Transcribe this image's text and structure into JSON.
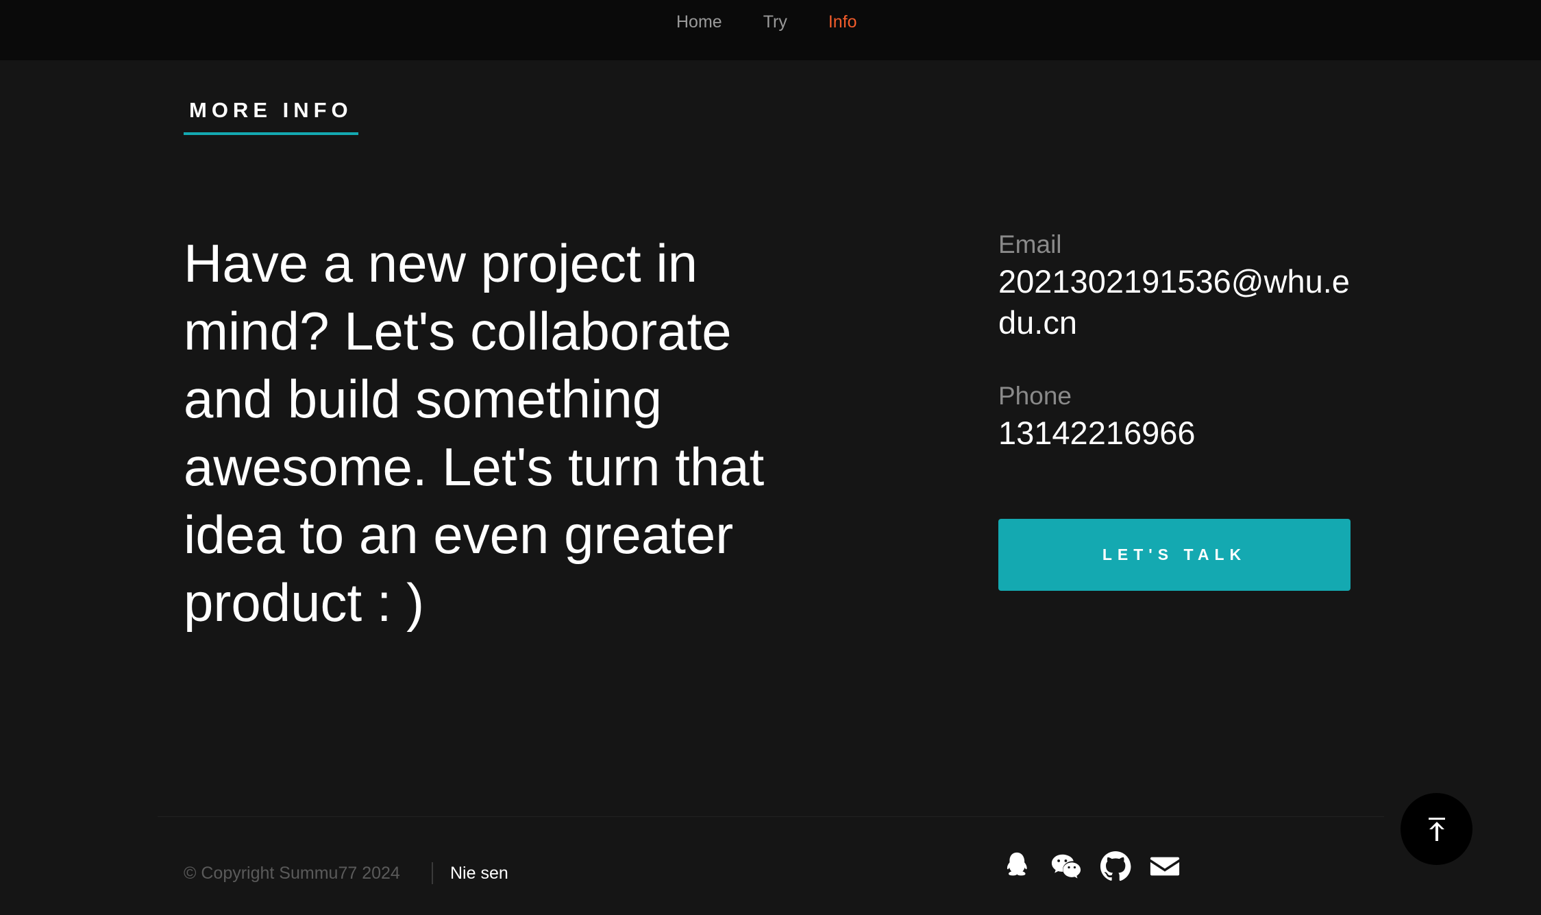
{
  "nav": {
    "items": [
      {
        "label": "Home",
        "active": false
      },
      {
        "label": "Try",
        "active": false
      },
      {
        "label": "Info",
        "active": true
      }
    ],
    "active_color": "#f25c2b"
  },
  "section": {
    "label": "MORE INFO"
  },
  "headline": "Have a new project in mind? Let's collaborate and build something awesome. Let's turn that idea to an even greater product : )",
  "contact": {
    "email_label": "Email",
    "email_value": "2021302191536@whu.edu.cn",
    "phone_label": "Phone",
    "phone_value": "13142216966"
  },
  "cta": {
    "label": "LET'S TALK",
    "color": "#14a9b1"
  },
  "footer": {
    "copyright": "© Copyright Summu77 2024",
    "author": "Nie sen",
    "social_icons": [
      "qq-icon",
      "wechat-icon",
      "github-icon",
      "email-icon"
    ]
  },
  "back_to_top": {
    "icon": "arrow-up-to-top-icon"
  }
}
